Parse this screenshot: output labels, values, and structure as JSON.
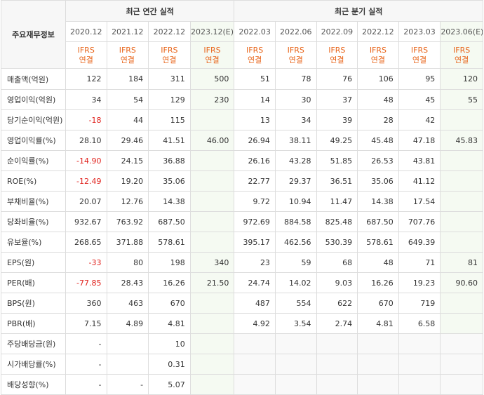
{
  "header": {
    "label": "주요재무정보",
    "annual_title": "최근 연간 실적",
    "quarterly_title": "최근 분기 실적"
  },
  "periods": [
    "2020.12",
    "2021.12",
    "2022.12",
    "2023.12(E)",
    "2022.03",
    "2022.06",
    "2022.09",
    "2022.12",
    "2023.03",
    "2023.06(E)"
  ],
  "ifrs_line1": "IFRS",
  "ifrs_line2": "연결",
  "rows": [
    {
      "label": "매출액(억원)",
      "values": [
        "122",
        "184",
        "311",
        "500",
        "51",
        "78",
        "76",
        "106",
        "95",
        "120"
      ]
    },
    {
      "label": "영업이익(억원)",
      "values": [
        "34",
        "54",
        "129",
        "230",
        "14",
        "30",
        "37",
        "48",
        "45",
        "55"
      ]
    },
    {
      "label": "당기순이익(억원)",
      "values": [
        "-18",
        "44",
        "115",
        "",
        "13",
        "34",
        "39",
        "28",
        "42",
        ""
      ]
    },
    {
      "label": "영업이익률(%)",
      "values": [
        "28.10",
        "29.46",
        "41.51",
        "46.00",
        "26.94",
        "38.11",
        "49.25",
        "45.48",
        "47.18",
        "45.83"
      ]
    },
    {
      "label": "순이익률(%)",
      "values": [
        "-14.90",
        "24.15",
        "36.88",
        "",
        "26.16",
        "43.28",
        "51.85",
        "26.53",
        "43.81",
        ""
      ]
    },
    {
      "label": "ROE(%)",
      "values": [
        "-12.49",
        "19.20",
        "35.06",
        "",
        "22.77",
        "29.37",
        "36.51",
        "35.06",
        "41.12",
        ""
      ]
    },
    {
      "label": "부채비율(%)",
      "values": [
        "20.07",
        "12.76",
        "14.38",
        "",
        "9.72",
        "10.94",
        "11.47",
        "14.38",
        "17.54",
        ""
      ]
    },
    {
      "label": "당좌비율(%)",
      "values": [
        "932.67",
        "763.92",
        "687.50",
        "",
        "972.69",
        "884.58",
        "825.48",
        "687.50",
        "707.76",
        ""
      ]
    },
    {
      "label": "유보율(%)",
      "values": [
        "268.65",
        "371.88",
        "578.61",
        "",
        "395.17",
        "462.56",
        "530.39",
        "578.61",
        "649.39",
        ""
      ]
    },
    {
      "label": "EPS(원)",
      "values": [
        "-33",
        "80",
        "198",
        "340",
        "23",
        "59",
        "68",
        "48",
        "71",
        "81"
      ]
    },
    {
      "label": "PER(배)",
      "values": [
        "-77.85",
        "28.43",
        "16.26",
        "21.50",
        "24.74",
        "14.02",
        "9.03",
        "16.26",
        "19.23",
        "90.60"
      ]
    },
    {
      "label": "BPS(원)",
      "values": [
        "360",
        "463",
        "670",
        "",
        "487",
        "554",
        "622",
        "670",
        "719",
        ""
      ]
    },
    {
      "label": "PBR(배)",
      "values": [
        "7.15",
        "4.89",
        "4.81",
        "",
        "4.92",
        "3.54",
        "2.74",
        "4.81",
        "6.58",
        ""
      ]
    },
    {
      "label": "주당배당금(원)",
      "values": [
        "-",
        "",
        "10",
        "",
        "",
        "",
        "",
        "",
        "",
        ""
      ]
    },
    {
      "label": "시가배당률(%)",
      "values": [
        "-",
        "",
        "0.31",
        "",
        "",
        "",
        "",
        "",
        "",
        ""
      ]
    },
    {
      "label": "배당성향(%)",
      "values": [
        "-",
        "-",
        "5.07",
        "",
        "",
        "",
        "",
        "",
        "",
        ""
      ]
    }
  ],
  "colors": {
    "negative": "#e0201b",
    "ifrs": "#e8651b",
    "estimate_bg": "#f5faf2"
  }
}
